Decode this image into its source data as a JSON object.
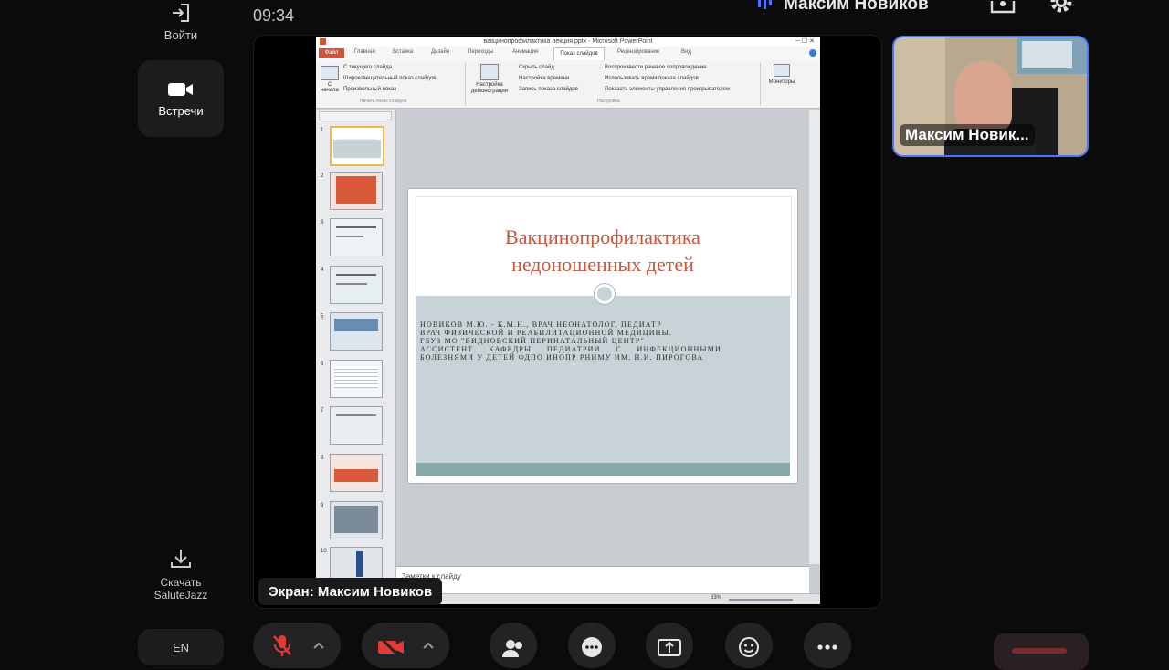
{
  "sidebar": {
    "login_label": "Войти",
    "meetings_label": "Встречи",
    "download_label_line1": "Скачать",
    "download_label_line2": "SaluteJazz",
    "lang_label": "EN"
  },
  "header": {
    "time": "09:34",
    "user_name": "Максим Новиков"
  },
  "screen_share": {
    "caption": "Экран: Максим Новиков"
  },
  "participant": {
    "name": "Максим Новик..."
  },
  "powerpoint": {
    "title": "вакцинопрофилактика лекция.pptx - Microsoft PowerPoint",
    "tabs": [
      "Файл",
      "Главная",
      "Вставка",
      "Дизайн",
      "Переходы",
      "Анимация",
      "Показ слайдов",
      "Рецензирование",
      "Вид"
    ],
    "ribbon_items": [
      "С текущего слайда",
      "Широковещательный показ слайдов",
      "Произвольный показ",
      "Настройка демонстрации",
      "Скрыть слайд",
      "Настройка времени",
      "Запись показа слайдов",
      "Воспроизвести речевое сопровождение",
      "Использовать время показа слайдов",
      "Показать элементы управления проигрывателем",
      "Мониторы"
    ],
    "ribbon_group_1": "Начать показ слайдов",
    "ribbon_group_2": "Настройка",
    "from_start_label": "С начала",
    "slide_numbers": [
      "1",
      "2",
      "3",
      "4",
      "5",
      "6",
      "7",
      "8",
      "9",
      "10"
    ],
    "slide": {
      "title_line1": "Вакцинопрофилактика",
      "title_line2": "недоношенных детей",
      "body_lines": [
        "НОВИКОВ М.Ю. - К.М.Н., ВРАЧ НЕОНАТОЛОГ, ПЕДИАТР",
        "ВРАЧ ФИЗИЧЕСКОЙ И РЕАБИЛИТАЦИОННОЙ МЕДИЦИНЫ.",
        "ГБУЗ МО \"ВИДНОВСКИЙ ПЕРИНАТАЛЬНЫЙ ЦЕНТР\"",
        "АССИСТЕНТ КАФЕДРЫ ПЕДИАТРИИ С ИНФЕКЦИОННЫМИ БОЛЕЗНЯМИ У ДЕТЕЙ ФДПО ИНОПР РНИМУ ИМ. Н.И. ПИРОГОВА"
      ]
    },
    "notes_placeholder": "Заметки к слайду",
    "zoom": "33%"
  },
  "colors": {
    "accent_blue": "#4a74ff",
    "title_orange": "#c9573d",
    "mic_red": "#e53935"
  }
}
